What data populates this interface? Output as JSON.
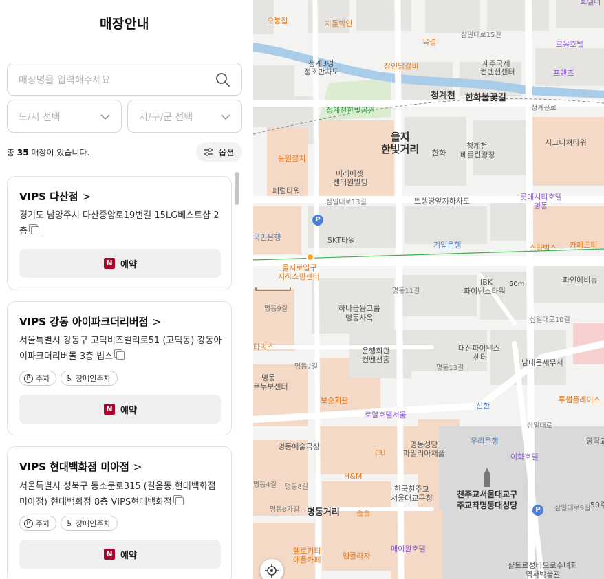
{
  "panel": {
    "title": "매장안내",
    "search_placeholder": "매장명을 입력해주세요",
    "city_select": "도/시 선택",
    "district_select": "시/구/군 선택",
    "count_prefix": "총 ",
    "count_value": "35",
    "count_suffix": " 매장이 있습니다.",
    "option_label": "옵션"
  },
  "stores": [
    {
      "name": "VIPS 다산점",
      "address": "경기도 남양주시 다산중앙로19번길 15LG베스트샵 2층",
      "chips": [],
      "reserve_label": "예약"
    },
    {
      "name": "VIPS 강동 아이파크더리버점",
      "address": "서울특별시 강동구 고덕비즈밸리로51 (고덕동) 강동아이파크더리버몰 3층 빕스",
      "chips": [
        "주차",
        "장애인주차"
      ],
      "reserve_label": "예약"
    },
    {
      "name": "VIPS 현대백화점 미아점",
      "address": "서울특별시 성북구 동소문로315 (길음동,현대백화점미아점) 현대백화점 8층 VIPS현대백화점",
      "chips": [
        "주차",
        "장애인주차"
      ],
      "reserve_label": "예약"
    }
  ],
  "map": {
    "scale": "50m",
    "labels": {
      "obong": "오봉집",
      "chadol": "차돌박인",
      "yukgyeol": "육결",
      "samil15": "삼일대로15길",
      "cheonggye3": "청계3경",
      "jeonggo": "정조반차도",
      "jangin": "장인닭갈비",
      "jeju": "제주국제",
      "jeju2": "컨벤션센터",
      "reum": "르몽호텔",
      "friends": "프렌즈",
      "cheonggyecheon": "청계천",
      "hanhwa_bul": "한화불꽃길",
      "cheonggyero": "청계천로",
      "park": "청계천한빛공원",
      "euljiro_title1": "을지",
      "euljiro_title2": "한빛거리",
      "hanhwa": "한화",
      "berlin1": "청계천",
      "berlin2": "베를린광장",
      "signature": "시그니쳐타워",
      "dongwon": "동원참치",
      "mirae1": "미래에셋",
      "mirae2": "센터원빌딩",
      "pyeollim": "페럼타워",
      "samil13": "삼일대로13길",
      "ppeong": "쁘렝땅앞지하차도",
      "lotte1": "롯데시티호텔",
      "lotte2": "명동",
      "kookmin": "국민은행",
      "skt": "SKT타워",
      "ibk": "기업은행",
      "starbucks": "스타벅스",
      "capedi": "카페드티",
      "euljiro_st1": "을지로입구",
      "euljiro_st2": "지하쇼핑센터",
      "ibk_fin1": "IBK",
      "ibk_fin2": "파이낸스타워",
      "paini": "파인에비뉴",
      "myeongdong11": "명동11길",
      "hana1": "하나금융그룹",
      "hana2": "명동사옥",
      "myeongdong9": "명동9길",
      "samil10": "삼일대로10길",
      "daeshin1": "대신파이낸스",
      "daeshin2": "센터",
      "taberks": "타벅스",
      "eunhaeng1": "은행회관",
      "eunhaeng2": "컨벤션홀",
      "namdae": "남대문세무서",
      "myeongdong_hotel1": "명동",
      "myeongdong_hotel2": "르누보센터",
      "myeongdong7": "명동7길",
      "myeongdong13": "명동13길",
      "bosung": "보승회관",
      "shinhan": "신한",
      "twoplace": "투썸플레이스",
      "loyal": "로얄호텔서울",
      "samilro": "삼일대로",
      "woori": "우리은행",
      "youngrak": "영락교",
      "yesul": "명동예술극장",
      "cu": "CU",
      "seongdang1": "명동성당",
      "seongdang2": "파밀리아채플",
      "ihwa": "이화호텔",
      "hm": "H&M",
      "myeongdong8": "명동8길",
      "hanguk1": "한국천주교",
      "hanguk2": "서울대교구청",
      "cathedral1": "천주교서울대교구",
      "cathedral2": "주교좌명동대성당",
      "myeongdong4": "명동4길",
      "myeongdong8b": "명동8가길",
      "myeonggeori": "명동거리",
      "solsol": "솔솔",
      "samil9": "삼일대로9길",
      "fifty": "50주",
      "hellokitty1": "헬로키티",
      "hellokitty2": "애플카페",
      "mpl": "엠플라자",
      "meiwon": "메이원호텔",
      "saint1": "샬트르성바오로수녀회",
      "saint2": "역사박물관",
      "hotel_top": "호텔더"
    }
  }
}
